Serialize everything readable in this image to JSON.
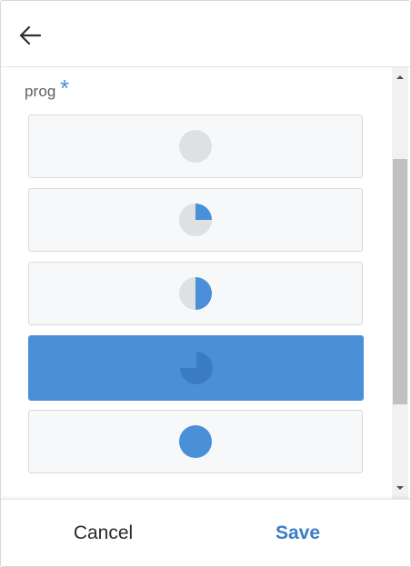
{
  "header": {
    "back_icon": "arrow-left-icon"
  },
  "field": {
    "label": "prog",
    "required_mark": "*"
  },
  "colors": {
    "accent": "#4a90d9",
    "empty": "#dfe0e2",
    "selected_icon": "#3a7cc4",
    "card_bg": "#f7f8fa",
    "save_text": "#3a7ec6"
  },
  "options": [
    {
      "progress": 0,
      "icon": "empty-circle-icon",
      "selected": false
    },
    {
      "progress": 0.25,
      "icon": "quarter-pie-icon",
      "selected": false
    },
    {
      "progress": 0.5,
      "icon": "half-pie-icon",
      "selected": false
    },
    {
      "progress": 0.75,
      "icon": "three-quarter-pie-icon",
      "selected": true
    },
    {
      "progress": 1,
      "icon": "full-circle-icon",
      "selected": false
    }
  ],
  "footer": {
    "cancel_label": "Cancel",
    "save_label": "Save"
  }
}
